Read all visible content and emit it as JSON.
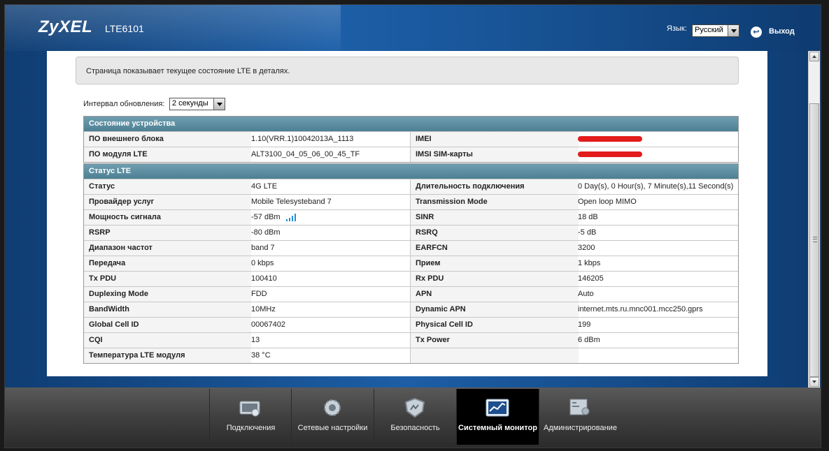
{
  "header": {
    "brand": "ZyXEL",
    "model": "LTE6101",
    "language_label": "Язык:",
    "language_value": "Русский",
    "logout_label": "Выход"
  },
  "page": {
    "description": "Страница показывает текущее состояние LTE в деталях.",
    "refresh_label": "Интервал обновления:",
    "refresh_value": "2 секунды"
  },
  "device_status": {
    "title": "Состояние устройства",
    "rows": [
      {
        "l1": "ПО внешнего блока",
        "v1": "1.10(VRR.1)10042013A_1113",
        "l2": "IMEI",
        "v2": ""
      },
      {
        "l1": "ПО модуля LTE",
        "v1": "ALT3100_04_05_06_00_45_TF",
        "l2": "IMSI SIM-карты",
        "v2": ""
      }
    ]
  },
  "lte_status": {
    "title": "Статус LTE",
    "rows": [
      {
        "l1": "Статус",
        "v1": "4G LTE",
        "l2": "Длительность подключения",
        "v2": "0 Day(s), 0 Hour(s), 7 Minute(s),11 Second(s)"
      },
      {
        "l1": "Провайдер услуг",
        "v1": "Mobile Telesysteband 7",
        "l2": "Transmission Mode",
        "v2": "Open loop MIMO"
      },
      {
        "l1": "Мощность сигнала",
        "v1": "-57 dBm",
        "l2": "SINR",
        "v2": "18 dB"
      },
      {
        "l1": "RSRP",
        "v1": "-80 dBm",
        "l2": "RSRQ",
        "v2": "-5 dB"
      },
      {
        "l1": "Диапазон частот",
        "v1": "band 7",
        "l2": "EARFCN",
        "v2": "3200"
      },
      {
        "l1": "Передача",
        "v1": "0 kbps",
        "l2": "Прием",
        "v2": "1 kbps"
      },
      {
        "l1": "Tx PDU",
        "v1": "100410",
        "l2": "Rx PDU",
        "v2": "146205"
      },
      {
        "l1": "Duplexing Mode",
        "v1": "FDD",
        "l2": "APN",
        "v2": "Auto"
      },
      {
        "l1": "BandWidth",
        "v1": "10MHz",
        "l2": "Dynamic APN",
        "v2": "internet.mts.ru.mnc001.mcc250.gprs"
      },
      {
        "l1": "Global Cell ID",
        "v1": "00067402",
        "l2": "Physical Cell ID",
        "v2": "199"
      },
      {
        "l1": "CQI",
        "v1": "13",
        "l2": "Tx Power",
        "v2": "6 dBm"
      },
      {
        "l1": "Температура LTE модуля",
        "v1": "38 °C",
        "l2": "",
        "v2": ""
      }
    ]
  },
  "nav": {
    "items": [
      {
        "label": "Подключения",
        "icon": "connection-icon"
      },
      {
        "label": "Сетевые настройки",
        "icon": "gear-icon"
      },
      {
        "label": "Безопасность",
        "icon": "shield-icon"
      },
      {
        "label": "Системный монитор",
        "icon": "monitor-chart-icon",
        "active": true
      },
      {
        "label": "Администрирование",
        "icon": "admin-icon"
      }
    ]
  },
  "colors": {
    "header_blue": "#124a86",
    "table_header": "#5b8ea2",
    "redaction": "#e21b1b",
    "signal_bars": "#1e8fd6"
  }
}
